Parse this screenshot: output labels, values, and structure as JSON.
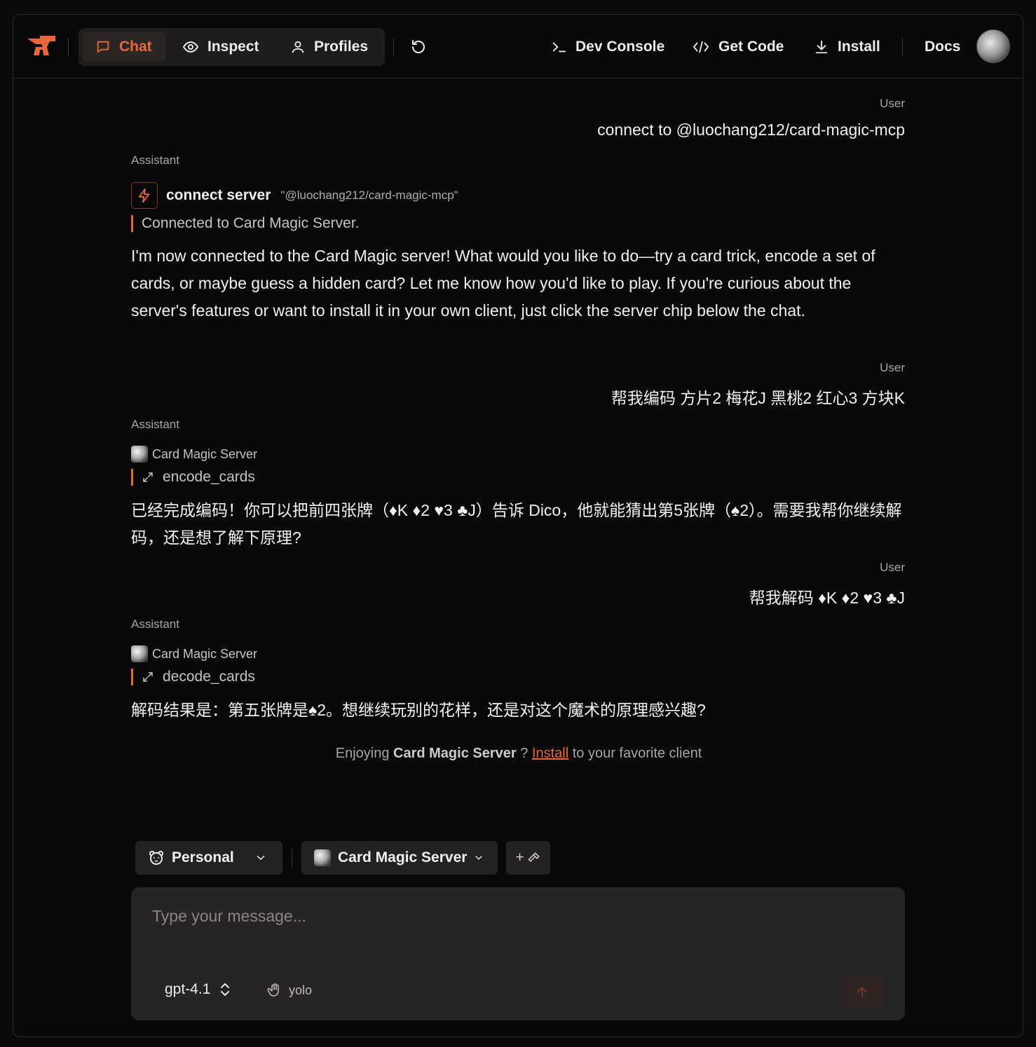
{
  "nav": {
    "tabs": [
      {
        "label": "Chat",
        "icon": "chat-bubble-icon",
        "active": true
      },
      {
        "label": "Inspect",
        "icon": "eye-icon"
      },
      {
        "label": "Profiles",
        "icon": "user-icon"
      }
    ],
    "dev_console": "Dev Console",
    "get_code": "Get Code",
    "install": "Install",
    "docs": "Docs"
  },
  "messages": {
    "m1_role": "User",
    "m1_text": "connect to @luochang212/card-magic-mcp",
    "m2_role": "Assistant",
    "m2_tool_name": "connect server",
    "m2_tool_arg": "\"@luochang212/card-magic-mcp\"",
    "m2_tool_result": "Connected to Card Magic Server.",
    "m2_text": "I'm now connected to the Card Magic server! What would you like to do—try a card trick, encode a set of cards, or maybe guess a hidden card? Let me know how you'd like to play. If you're curious about the server's features or want to install it in your own client, just click the server chip below the chat.",
    "m3_role": "User",
    "m3_text": "帮我编码 方片2 梅花J 黑桃2 红心3 方块K",
    "m4_role": "Assistant",
    "m4_server": "Card Magic Server",
    "m4_tool": "encode_cards",
    "m4_text": "已经完成编码！你可以把前四张牌（♦K ♦2 ♥3 ♣J）告诉 Dico，他就能猜出第5张牌（♠2）。需要我帮你继续解码，还是想了解下原理?",
    "m5_role": "User",
    "m5_text": "帮我解码 ♦K ♦2 ♥3 ♣J",
    "m6_role": "Assistant",
    "m6_server": "Card Magic Server",
    "m6_tool": "decode_cards",
    "m6_text": "解码结果是：第五张牌是♠2。想继续玩别的花样，还是对这个魔术的原理感兴趣?"
  },
  "promo": {
    "prefix": "Enjoying",
    "server": "Card Magic Server",
    "qmark": "?",
    "link": "Install",
    "suffix": "to your favorite client"
  },
  "composer": {
    "profile": "Personal",
    "server": "Card Magic Server",
    "add_label": "+",
    "placeholder": "Type your message...",
    "model": "gpt-4.1",
    "mode": "yolo"
  },
  "colors": {
    "accent": "#e8683b",
    "background": "#0a0909",
    "panel": "#262424"
  }
}
